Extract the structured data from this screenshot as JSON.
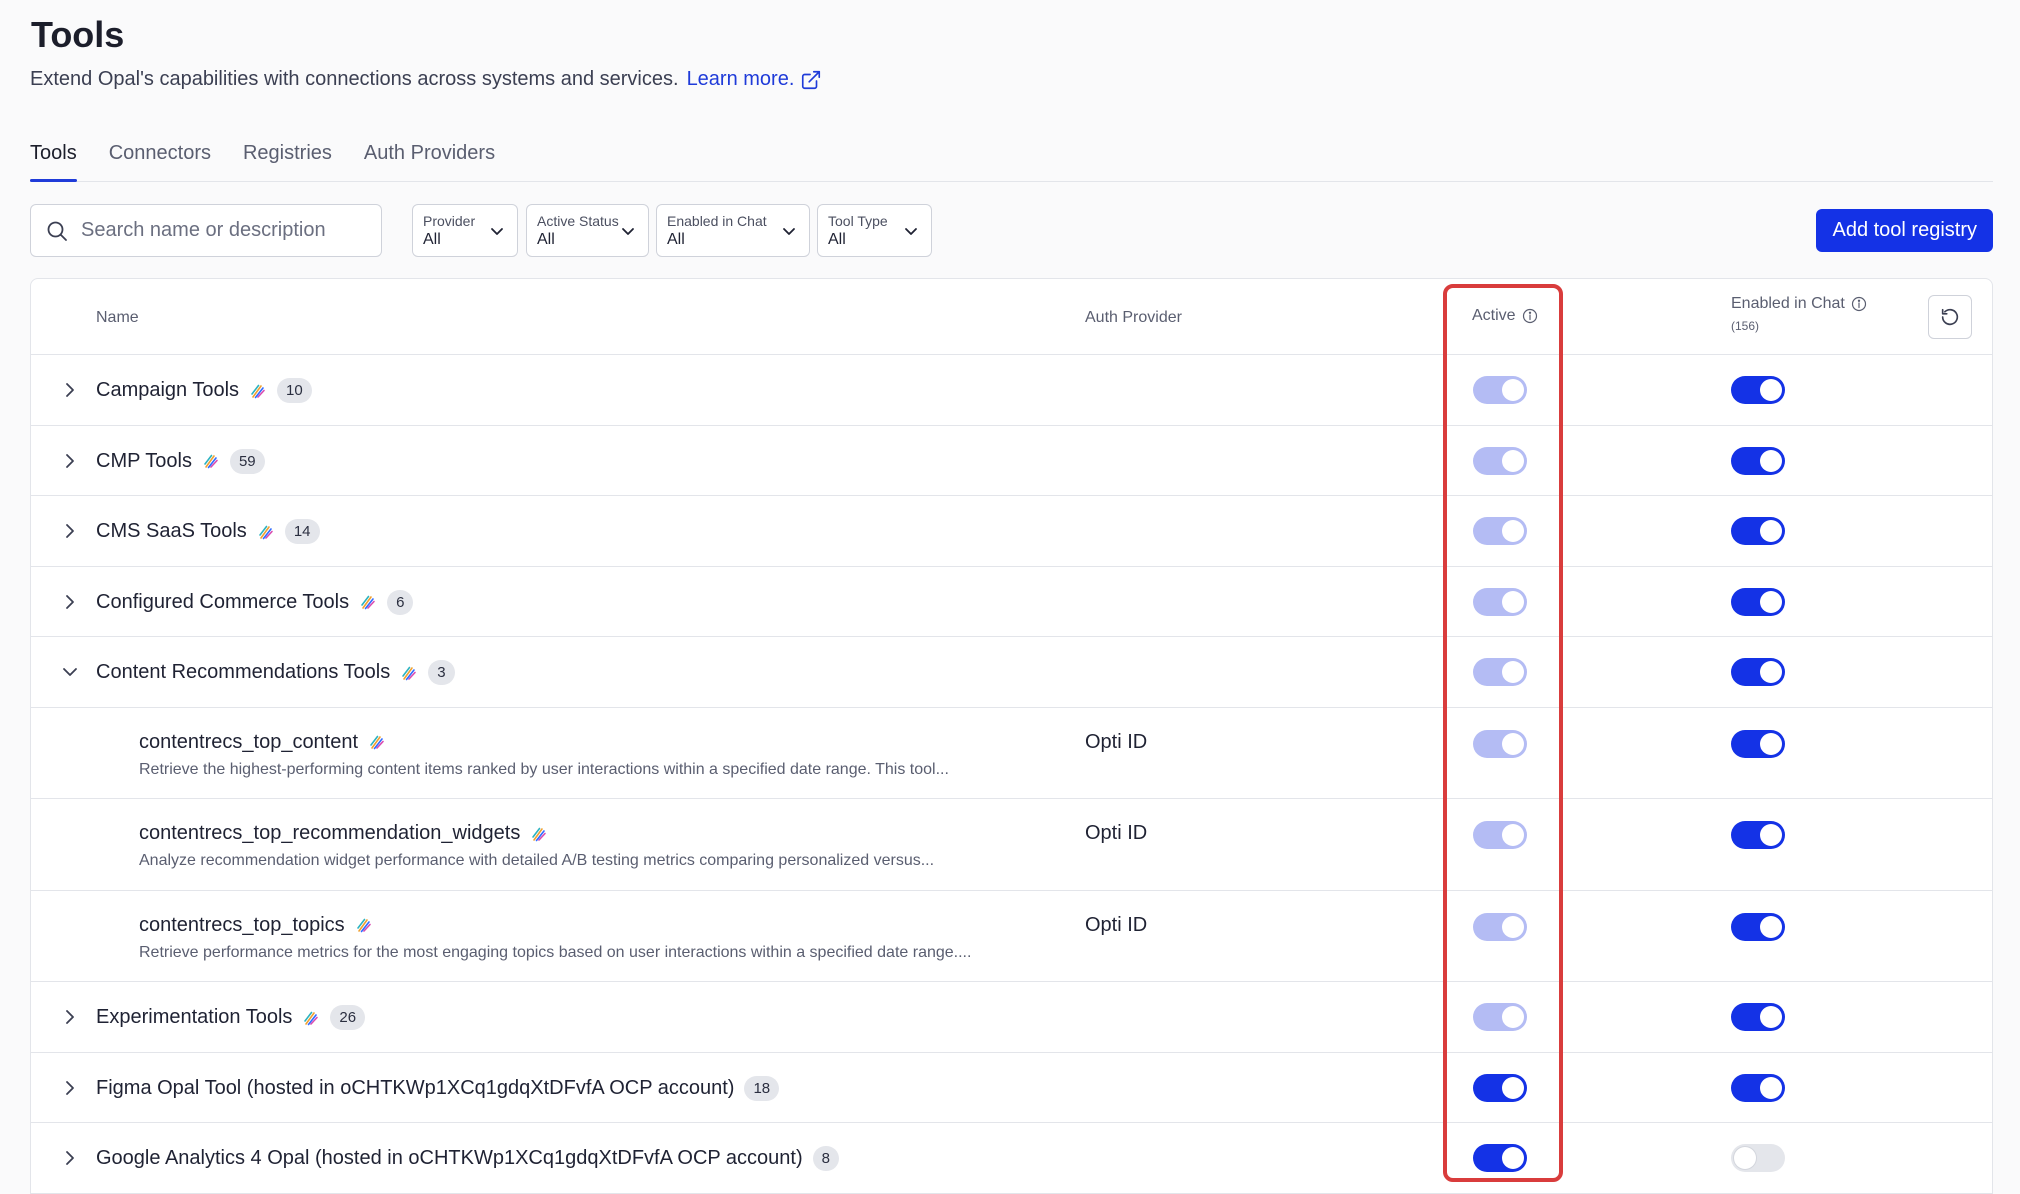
{
  "page": {
    "title": "Tools",
    "subtitle": "Extend Opal's capabilities with connections across systems and services.",
    "learn_more": "Learn more."
  },
  "tabs": [
    {
      "label": "Tools",
      "active": true
    },
    {
      "label": "Connectors",
      "active": false
    },
    {
      "label": "Registries",
      "active": false
    },
    {
      "label": "Auth Providers",
      "active": false
    }
  ],
  "search": {
    "placeholder": "Search name or description",
    "value": ""
  },
  "filters": [
    {
      "label": "Provider",
      "value": "All"
    },
    {
      "label": "Active Status",
      "value": "All"
    },
    {
      "label": "Enabled in Chat",
      "value": "All"
    },
    {
      "label": "Tool Type",
      "value": "All"
    }
  ],
  "add_button": "Add tool registry",
  "table": {
    "headers": {
      "name": "Name",
      "auth_provider": "Auth Provider",
      "active": "Active",
      "enabled_in_chat": "Enabled in Chat",
      "enabled_count": "(156)"
    },
    "rows": [
      {
        "type": "group",
        "name": "Campaign Tools",
        "count": "10",
        "expanded": false,
        "opal_icon": true,
        "active": "dim",
        "chat": "on"
      },
      {
        "type": "group",
        "name": "CMP Tools",
        "count": "59",
        "expanded": false,
        "opal_icon": true,
        "active": "dim",
        "chat": "on"
      },
      {
        "type": "group",
        "name": "CMS SaaS Tools",
        "count": "14",
        "expanded": false,
        "opal_icon": true,
        "active": "dim",
        "chat": "on"
      },
      {
        "type": "group",
        "name": "Configured Commerce Tools",
        "count": "6",
        "expanded": false,
        "opal_icon": true,
        "active": "dim",
        "chat": "on"
      },
      {
        "type": "group",
        "name": "Content Recommendations Tools",
        "count": "3",
        "expanded": true,
        "opal_icon": true,
        "active": "dim",
        "chat": "on"
      },
      {
        "type": "child",
        "name": "contentrecs_top_content",
        "description": "Retrieve the highest-performing content items ranked by user interactions within a specified date range. This tool...",
        "auth": "Opti ID",
        "active": "dim",
        "chat": "on"
      },
      {
        "type": "child",
        "name": "contentrecs_top_recommendation_widgets",
        "description": "Analyze recommendation widget performance with detailed A/B testing metrics comparing personalized versus...",
        "auth": "Opti ID",
        "active": "dim",
        "chat": "on"
      },
      {
        "type": "child",
        "name": "contentrecs_top_topics",
        "description": "Retrieve performance metrics for the most engaging topics based on user interactions within a specified date range....",
        "auth": "Opti ID",
        "active": "dim",
        "chat": "on"
      },
      {
        "type": "group",
        "name": "Experimentation Tools",
        "count": "26",
        "expanded": false,
        "opal_icon": true,
        "active": "dim",
        "chat": "on"
      },
      {
        "type": "group",
        "name": "Figma Opal Tool (hosted in oCHTKWp1XCq1gdqXtDFvfA OCP account)",
        "count": "18",
        "expanded": false,
        "opal_icon": false,
        "active": "on",
        "chat": "on"
      },
      {
        "type": "group",
        "name": "Google Analytics 4 Opal (hosted in oCHTKWp1XCq1gdqXtDFvfA OCP account)",
        "count": "8",
        "expanded": false,
        "opal_icon": false,
        "active": "on",
        "chat": "off"
      }
    ]
  },
  "colors": {
    "accent": "#1432e6",
    "toggle_disabled": "#b4bcf4",
    "highlight": "#d93c3c"
  }
}
